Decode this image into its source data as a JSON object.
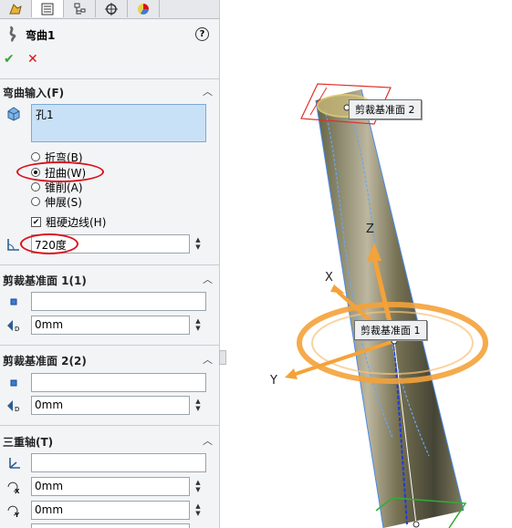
{
  "tabs": [
    {
      "icon": "feature-manager-icon"
    },
    {
      "icon": "property-manager-icon"
    },
    {
      "icon": "configuration-manager-icon"
    },
    {
      "icon": "dimxpert-icon"
    },
    {
      "icon": "display-manager-icon"
    }
  ],
  "feature": {
    "title": "弯曲1",
    "help": "?",
    "ok": "✔",
    "cancel": "✕"
  },
  "bend_input": {
    "heading": "弯曲输入(F)",
    "selection": "孔1",
    "options": [
      "折弯(B)",
      "扭曲(W)",
      "锥削(A)",
      "伸展(S)"
    ],
    "selected_option": "扭曲(W)",
    "rigid_edges_label": "粗硬边线(H)",
    "rigid_edges_checked": true,
    "angle": "720度"
  },
  "trim_plane_1": {
    "heading": "剪裁基准面 1(1)",
    "reference": "",
    "distance": "0mm"
  },
  "trim_plane_2": {
    "heading": "剪裁基准面 2(2)",
    "reference": "",
    "distance": "0mm"
  },
  "triad": {
    "heading": "三重轴(T)",
    "reference": "",
    "x": "0mm",
    "y": "0mm"
  },
  "viewport": {
    "callout_plane_1": "剪裁基准面 1",
    "callout_plane_2": "剪裁基准面 2",
    "axis_x": "X",
    "axis_y": "Y",
    "axis_z": "Z"
  },
  "colors": {
    "accent_red": "#d9121b",
    "triad_orange": "#f4a23a",
    "selection_blue": "#c9e1f7",
    "ok_green": "#3aa33a"
  }
}
